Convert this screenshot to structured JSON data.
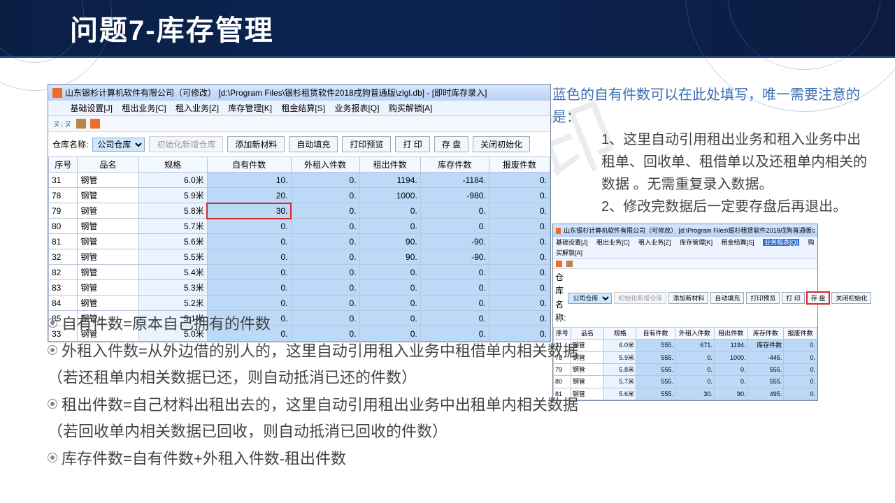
{
  "header": {
    "title": "问题7-库存管理"
  },
  "right": {
    "lead": "蓝色的自有件数可以在此处填写，唯一需要注意的是：",
    "p1": "1、这里自动引用租出业务和租入业务中出租单、回收单、租借单以及还租单内相关的数据 。无需重复录入数据。",
    "p2": "2、修改完数据后一定要存盘后再退出。"
  },
  "bullets": {
    "b1": "自有件数=原本自己拥有的件数",
    "b2": "外租入件数=从外边借的别人的，这里自动引用租入业务中租借单内相关数据",
    "b2p": "（若还租单内相关数据已还，则自动抵消已还的件数）",
    "b3": "租出件数=自己材料出租出去的，这里自动引用租出业务中出租单内相关数据",
    "b3p": "（若回收单内相关数据已回收，则自动抵消已回收的件数）",
    "b4": "库存件数=自有件数+外租入件数-租出件数"
  },
  "watermark": "非会员水印",
  "app": {
    "title": "山东银杉计算机软件有限公司（可修改）   [d:\\Program Files\\银杉租赁软件2018戌狗普通版\\zlgl.db] - [即时库存录入]",
    "menu": [
      "基础设置[J]",
      "租出业务[C]",
      "租入业务[Z]",
      "库存管理[K]",
      "租金结算[S]",
      "业务报表[Q]",
      "购买解锁[A]"
    ],
    "form": {
      "whlabel": "仓库名称:",
      "whsel": "公司仓库",
      "btn_init": "初始化新增仓库",
      "btn_add": "添加新材料",
      "btn_fill": "自动填充",
      "btn_pre": "打印预览",
      "btn_print": "打 印",
      "btn_save": "存 盘",
      "btn_close": "关闭初始化"
    },
    "cols": [
      "序号",
      "品名",
      "规格",
      "自有件数",
      "外租入件数",
      "租出件数",
      "库存件数",
      "报废件数"
    ],
    "rows": [
      [
        "31",
        "钢管",
        "6.0米",
        "10.",
        "0.",
        "1194.",
        "-1184.",
        "0."
      ],
      [
        "78",
        "钢管",
        "5.9米",
        "20.",
        "0.",
        "1000.",
        "-980.",
        "0."
      ],
      [
        "79",
        "钢管",
        "5.8米",
        "30.",
        "0.",
        "0.",
        "0.",
        "0."
      ],
      [
        "80",
        "钢管",
        "5.7米",
        "0.",
        "0.",
        "0.",
        "0.",
        "0."
      ],
      [
        "81",
        "钢管",
        "5.6米",
        "0.",
        "0.",
        "90.",
        "-90.",
        "0."
      ],
      [
        "32",
        "钢管",
        "5.5米",
        "0.",
        "0.",
        "90.",
        "-90.",
        "0."
      ],
      [
        "82",
        "钢管",
        "5.4米",
        "0.",
        "0.",
        "0.",
        "0.",
        "0."
      ],
      [
        "83",
        "钢管",
        "5.3米",
        "0.",
        "0.",
        "0.",
        "0.",
        "0."
      ],
      [
        "84",
        "钢管",
        "5.2米",
        "0.",
        "0.",
        "0.",
        "0.",
        "0."
      ],
      [
        "85",
        "钢管",
        "5.1米",
        "0.",
        "0.",
        "0.",
        "0.",
        "0."
      ],
      [
        "33",
        "钢管",
        "5.0米",
        "0.",
        "0.",
        "0.",
        "0.",
        "0."
      ]
    ]
  },
  "thumb": {
    "title": "山东银杉计算机软件有限公司（可修改）  [d:\\Program Files\\银杉租赁软件2018戌狗普通版\\zlgl.db] - [即时库存录入]",
    "menu": [
      "基础设置[J]",
      "租出业务[C]",
      "租入业务[Z]",
      "库存管理[K]",
      "租金结算[S]",
      "业务报表[Q]",
      "购买解锁[A]"
    ],
    "rows": [
      [
        "31",
        "钢管",
        "6.0米",
        "555.",
        "671.",
        "1194.",
        "库存件数",
        "0."
      ],
      [
        "78",
        "钢管",
        "5.9米",
        "555.",
        "0.",
        "1000.",
        "-445.",
        "0."
      ],
      [
        "79",
        "钢管",
        "5.8米",
        "555.",
        "0.",
        "0.",
        "555.",
        "0."
      ],
      [
        "80",
        "钢管",
        "5.7米",
        "555.",
        "0.",
        "0.",
        "555.",
        "0."
      ],
      [
        "81",
        "钢管",
        "5.6米",
        "555.",
        "30.",
        "90.",
        "495.",
        "0."
      ]
    ]
  }
}
